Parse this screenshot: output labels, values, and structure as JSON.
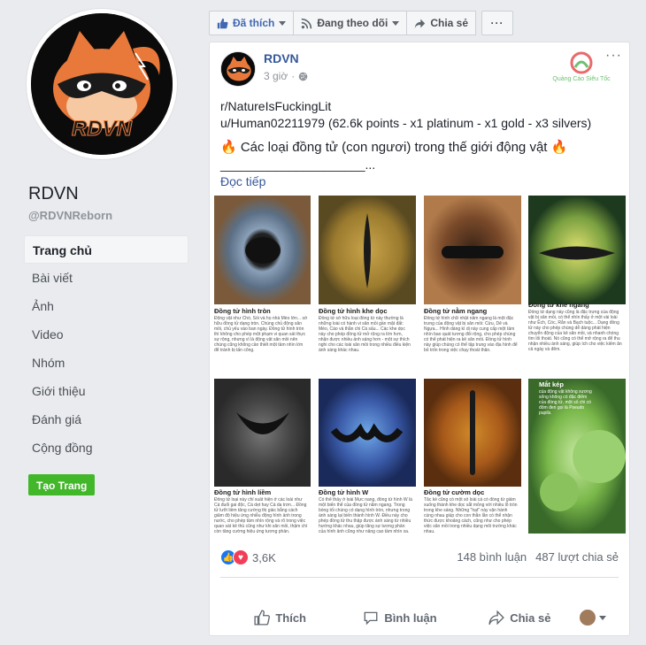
{
  "page": {
    "name": "RDVN",
    "handle": "@RDVNReborn",
    "avatar_text": "RDVN"
  },
  "nav": {
    "items": [
      {
        "label": "Trang chủ",
        "active": true
      },
      {
        "label": "Bài viết",
        "active": false
      },
      {
        "label": "Ảnh",
        "active": false
      },
      {
        "label": "Video",
        "active": false
      },
      {
        "label": "Nhóm",
        "active": false
      },
      {
        "label": "Giới thiệu",
        "active": false
      },
      {
        "label": "Đánh giá",
        "active": false
      },
      {
        "label": "Cộng đồng",
        "active": false
      }
    ],
    "create_page": "Tạo Trang"
  },
  "actionbar": {
    "liked": "Đã thích",
    "following": "Đang theo dõi",
    "share": "Chia sẻ",
    "more": "···"
  },
  "post": {
    "author": "RDVN",
    "time": "3 giờ",
    "menu": "···",
    "line1": "r/NatureIsFuckingLit",
    "line2": "u/Human02211979 (62.6k points - x1 platinum - x1 gold - x3 silvers)",
    "line3": "🔥 Các loại đồng tử (con ngươi) trong thế giới động vật 🔥",
    "line4": "_____________________...",
    "read_more": "Đọc tiếp",
    "watermark": "Quảng Cáo Siêu Tốc",
    "image": {
      "captions": [
        "Đồng tử hình tròn",
        "Đồng tử hình khe dọc",
        "Đồng tử nằm ngang",
        "Đồng tử khe ngang",
        "Đồng tử hình liềm",
        "Đồng tử hình W",
        "Đồng tử cườm dọc",
        "Mắt kép"
      ],
      "descs": [
        "Động vật như Chó, Sói và họ nhà Mèo lớn... sở hữu đồng tử dạng tròn. Chúng chủ động săn mồi, chủ yếu vào ban ngày. Đồng tử hình tròn thì không cho phép một phạm vi quan sát thực sự rộng, nhưng vì là động vật săn mồi nên chúng cũng không cần thiết một tầm nhìn lớn để tránh bị tấn công.",
        "Đồng tử sở hữu loại đồng tử này thường là những loài có hành vi săn mồi gần mặt đất: Mèo, Cáo và thằn chi Cá sấu... Các khe dọc này cho phép đồng tử mở rộng ra lớn hơn, nhận được nhiều ánh sáng hơn - một sự thích nghi cho các loài săn mồi trong nhiều điều kiện ánh sáng khác nhau.",
        "Đồng tử hình chữ nhật nằm ngang là một đặc trưng của động vật bị săn mồi: Cừu, Dê và Ngựa... Hình dáng kì dị này cung cấp một tầm nhìn bao quát tương đối rộng, cho phép chúng có thể phát hiện ra kẻ săn mồi. Đồng tử hình này giúp chúng có thể tập trung vào địa hình để bỏ trốn trong việc chạy thoát thân.",
        "Đồng tử dạng này cũng là đặc trưng của động vật bị săn mồi, có thể nhìn thấy ở một vài loài như Ếch, Cóc, Rắn và Bạch tuộc... Dạng đồng tử này cho phép chúng dễ dàng phát hiện chuyển động của kẻ săn mồi, và nhanh chóng tìm lối thoát. Nó cũng có thể mở rộng ra để thu nhận nhiều ánh sáng, giúp ích cho việc kiếm ăn cả ngày và đêm.",
        "Đồng tử loại này chỉ xuất hiện ở các loài như Cá đuối gai độc, Cá dẹt hay Cá da trơn... Đồng tử lưỡi liềm tăng cường thị giác bằng cách giảm độ hiệu ứng nhiễu động hình ảnh trong nước, cho phép tầm nhìn rộng và rõ trong việc quan sát kẻ thù cũng như khi săn mồi, thậm chí còn tăng cường hiệu ứng tương phản.",
        "Có thể thấy ở loài Mực nang, đồng tử hình W là một biến thể của đồng tử nằm ngang. Trong bóng tối chúng có dạng hình tròn, nhưng trong ánh sáng lại biến thành hình W. Điều này cho phép đồng tử thu thập được ánh sáng từ nhiều hướng khác nhau, giúp tăng sự tương phản của hình ảnh cũng như nâng cao tầm nhìn xa.",
        "Tắc kè cũng có một số loài cá có đồng tử giảm xuống thành khe dọc sắt mỏng với nhiều lỗ tròn trong khe sáng. Những \"hạt\" này vận hành cùng nhau giúp cho con thằn lằn có thể nhận thức được khoảng cách, cũng như cho phép việc săn mồi trong nhiều dạng môi trường khác nhau.",
        "của động vật không xương sống không có đặc điểm của đồng tử, một số chi có đốm đen gọi là Pseudo pupils."
      ]
    },
    "reactions_count": "3,6K",
    "comments": "148 bình luận",
    "shares": "487 lượt chia sẻ",
    "like": "Thích",
    "comment": "Bình luận",
    "share": "Chia sẻ"
  },
  "colors": {
    "brand_blue": "#365899",
    "create_green": "#42b72a",
    "like_blue": "#1877f2",
    "love_red": "#f33e58",
    "bg": "#e9ebee"
  }
}
